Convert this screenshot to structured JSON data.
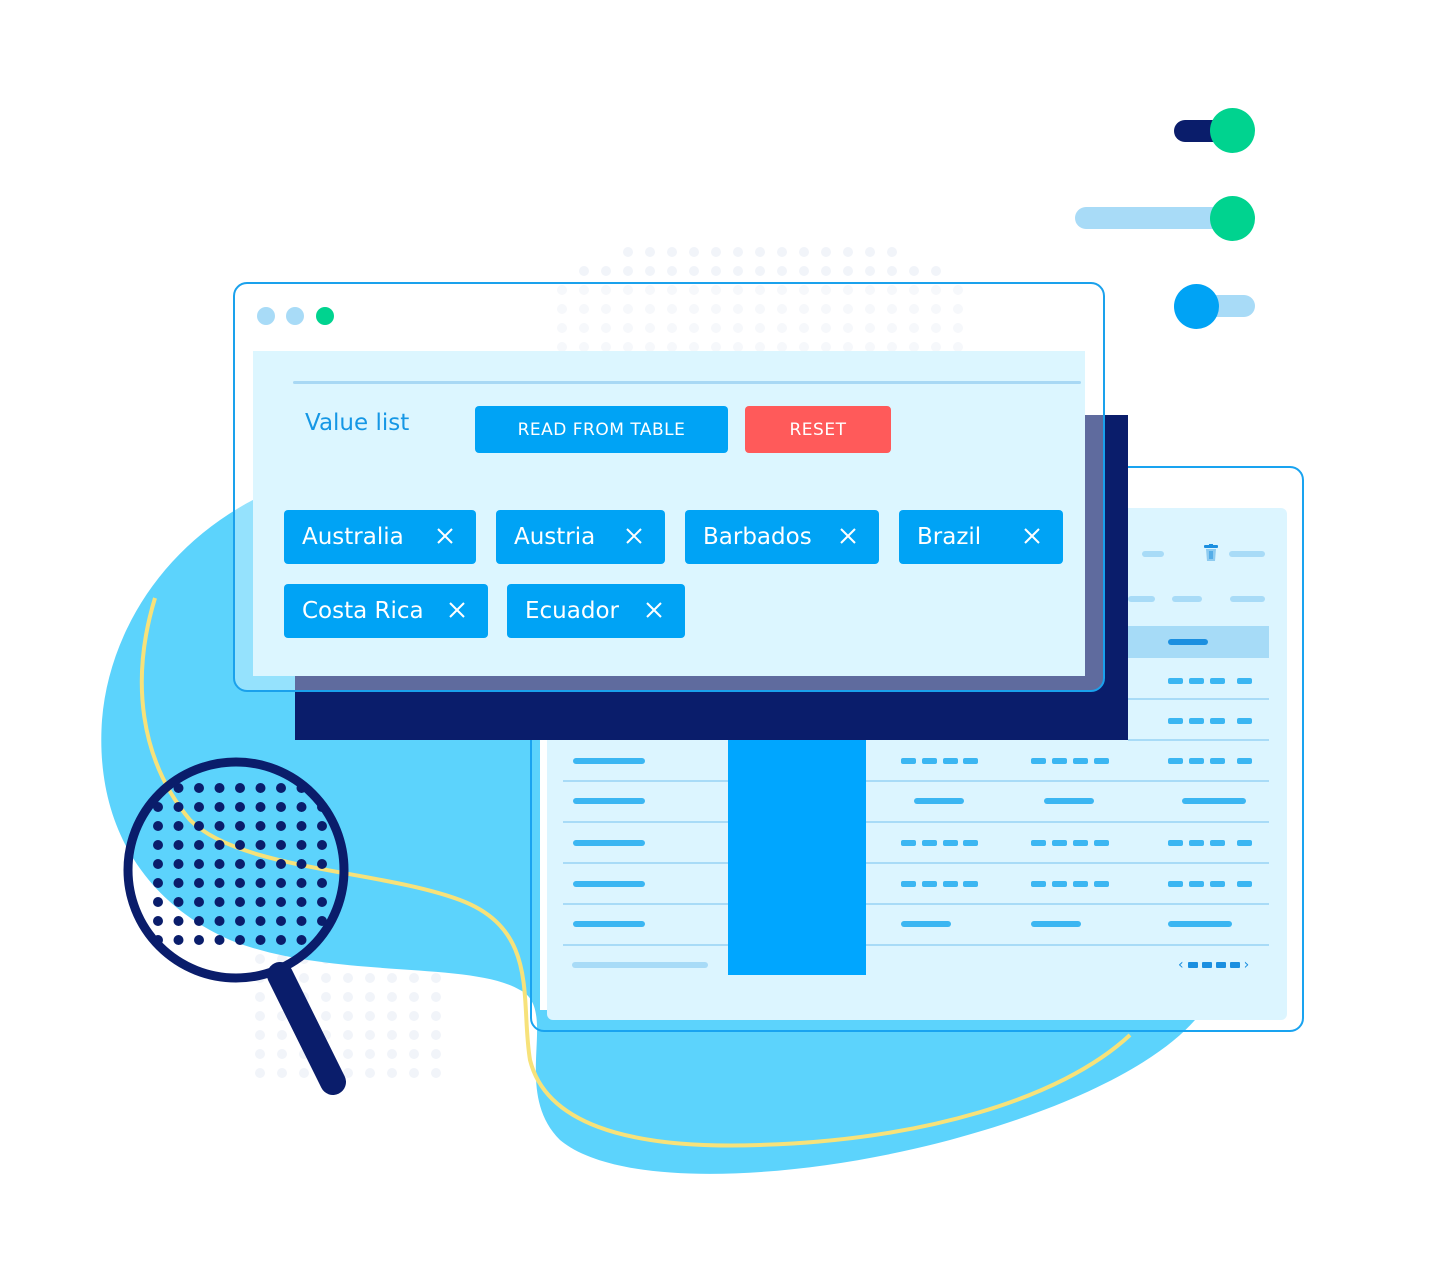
{
  "illustration": {
    "theme_colors": {
      "primary_blue": "#00a3f5",
      "navy": "#0a1d6b",
      "green": "#00d38f",
      "light_blue": "#a8dbf7",
      "blob_blue": "#5cd3fc",
      "panel_bg": "#dcf6ff",
      "reset_red": "#ff5a5a",
      "accent_yellow": "#f7e27a"
    }
  },
  "toggles": [
    {
      "name": "toggle-1",
      "state": "on",
      "knob_color": "#00d38f",
      "track_color": "#0a1d6b"
    },
    {
      "name": "slider-1",
      "value_percent": 100,
      "knob_color": "#00d38f",
      "track_color": "#a8dbf7"
    },
    {
      "name": "toggle-2",
      "state": "off",
      "knob_color": "#00a3f5",
      "track_color": "#a8dbf7"
    }
  ],
  "front_window": {
    "window_controls": [
      "light-blue",
      "light-blue",
      "green"
    ],
    "value_list_label": "Value list",
    "read_from_table_label": "READ FROM TABLE",
    "reset_label": "RESET",
    "chips": [
      {
        "label": "Australia"
      },
      {
        "label": "Austria"
      },
      {
        "label": "Barbados"
      },
      {
        "label": "Brazil"
      },
      {
        "label": "Costa Rica"
      },
      {
        "label": "Ecuador"
      }
    ],
    "chip_remove_icon": "close-icon"
  },
  "back_window": {
    "header_icons": [
      "trash-icon"
    ],
    "pager": {
      "prev": "‹",
      "next": "›",
      "pages": 4
    }
  }
}
